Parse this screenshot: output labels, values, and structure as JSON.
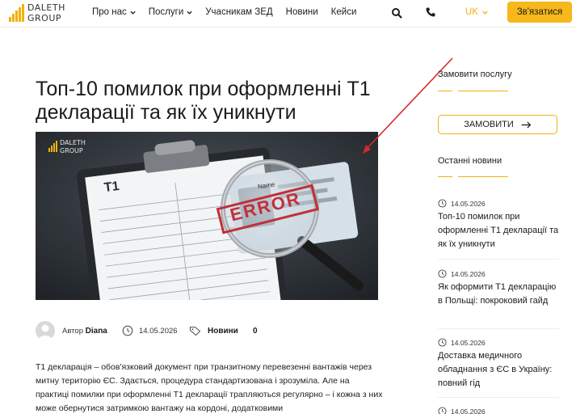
{
  "header": {
    "logo_text_top": "DALETH",
    "logo_text_bottom": "GROUP",
    "nav": [
      {
        "label": "Про нас",
        "dropdown": true
      },
      {
        "label": "Послуги",
        "dropdown": true
      },
      {
        "label": "Учасникам ЗЕД",
        "dropdown": false
      },
      {
        "label": "Новини",
        "dropdown": false
      },
      {
        "label": "Кейси",
        "dropdown": false
      }
    ],
    "search_icon": "search-icon",
    "phone_icon": "phone-icon",
    "lang": "UK",
    "cta": "Зв'язатися"
  },
  "article": {
    "title": "Топ-10 помилок при оформленні Т1 декларації та як їх уникнути",
    "image_watermark_top": "DALETH",
    "image_watermark_bottom": "GROUP",
    "image_form_title": "T1",
    "image_stamp": "ERROR",
    "image_card_label": "Name",
    "author_prefix": "Автор",
    "author": "Diana",
    "date": "14.05.2026",
    "category": "Новини",
    "comments": "0",
    "body": "Т1 декларація – обов'язковий документ при транзитному перевезенні вантажів через митну територію ЄС. Здається, процедура стандартизована і зрозуміла. Але на практиці помилки при оформленні Т1 декларації трапляються регулярно – і кожна з них може обернутися затримкою вантажу на кордоні, додатковими"
  },
  "sidebar": {
    "order_heading": "Замовити послугу",
    "order_button": "ЗАМОВИТИ",
    "news_heading": "Останні новини",
    "news": [
      {
        "date": "14.05.2026",
        "title": "Топ-10 помилок при оформленні Т1 декларації та як їх уникнути"
      },
      {
        "date": "14.05.2026",
        "title": "Як оформити Т1 декларацію в Польщі: покроковий гайд"
      },
      {
        "date": "14.05.2026",
        "title": "Доставка медичного обладнання з ЄС в Україну: повний гід"
      },
      {
        "date": "14.05.2026",
        "title": ""
      }
    ]
  },
  "colors": {
    "accent": "#f6b81a",
    "annotation_arrow": "#d3292b"
  }
}
